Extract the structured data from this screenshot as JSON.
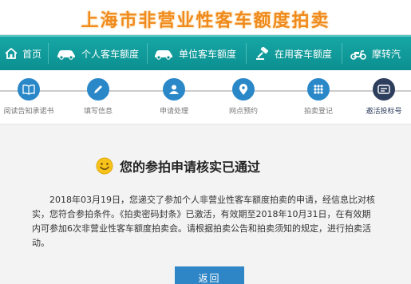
{
  "site": {
    "title": "上海市非营业性客车额度拍卖"
  },
  "nav": [
    {
      "label": "首页",
      "icon": "home-icon"
    },
    {
      "label": "个人客车额度",
      "icon": "car-icon"
    },
    {
      "label": "单位客车额度",
      "icon": "car-icon"
    },
    {
      "label": "在用客车额度",
      "icon": "gavel-icon"
    },
    {
      "label": "摩转汽",
      "icon": "scooter-icon"
    }
  ],
  "steps": [
    {
      "label": "阅读告知承诺书",
      "state": "done"
    },
    {
      "label": "填写信息",
      "state": "done"
    },
    {
      "label": "申请处理",
      "state": "done"
    },
    {
      "label": "网点预约",
      "state": "done"
    },
    {
      "label": "拍卖登记",
      "state": "done"
    },
    {
      "label": "邀活投标号",
      "state": "current"
    }
  ],
  "result": {
    "title": "您的参拍申请核实已通过",
    "message": "2018年03月19日，您递交了参加个人非营业性客车额度拍卖的申请，经信息比对核实，您符合参拍条件。《拍卖密码封条》已激活，有效期至2018年10月31日，在有效期内可参加6次非营业性客车额度拍卖会。请根据拍卖公告和拍卖须知的规定，进行拍卖活动。",
    "icon": "smiley-icon"
  },
  "actions": {
    "back_label": "返回"
  },
  "colors": {
    "nav": "#0b8f8f",
    "accent": "#f08a1c",
    "step_done": "#2a88c9",
    "step_current": "#2e3f5e",
    "button": "#2f86c6"
  }
}
